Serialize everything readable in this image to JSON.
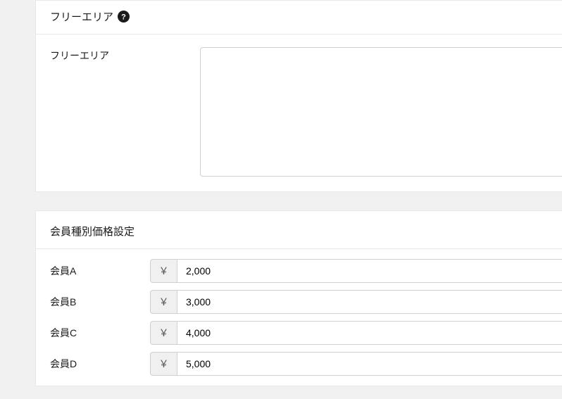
{
  "freeArea": {
    "sectionTitle": "フリーエリア",
    "fieldLabel": "フリーエリア",
    "value": ""
  },
  "memberPricing": {
    "sectionTitle": "会員種別価格設定",
    "currencySymbol": "￥",
    "rows": [
      {
        "label": "会員A",
        "value": "2,000"
      },
      {
        "label": "会員B",
        "value": "3,000"
      },
      {
        "label": "会員C",
        "value": "4,000"
      },
      {
        "label": "会員D",
        "value": "5,000"
      }
    ]
  }
}
